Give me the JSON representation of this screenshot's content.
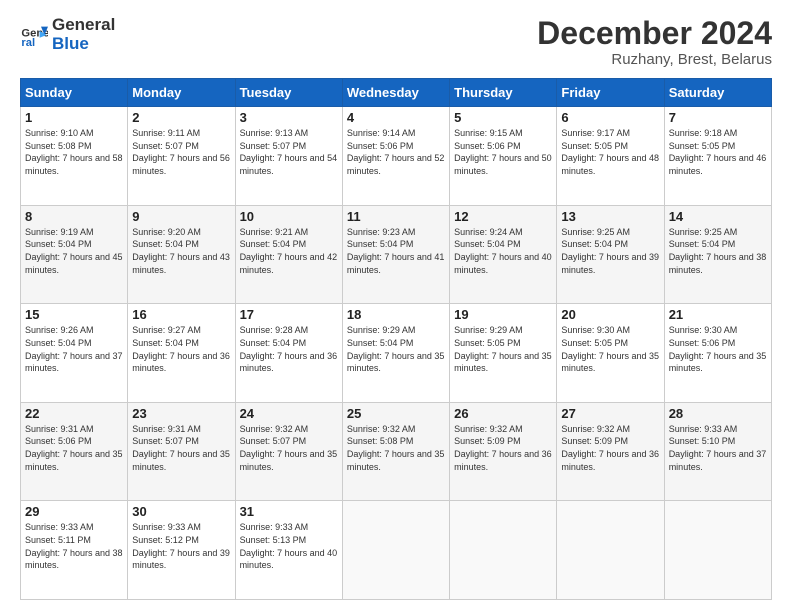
{
  "logo": {
    "line1": "General",
    "line2": "Blue"
  },
  "header": {
    "title": "December 2024",
    "subtitle": "Ruzhany, Brest, Belarus"
  },
  "weekdays": [
    "Sunday",
    "Monday",
    "Tuesday",
    "Wednesday",
    "Thursday",
    "Friday",
    "Saturday"
  ],
  "weeks": [
    [
      {
        "day": "1",
        "sunrise": "Sunrise: 9:10 AM",
        "sunset": "Sunset: 5:08 PM",
        "daylight": "Daylight: 7 hours and 58 minutes."
      },
      {
        "day": "2",
        "sunrise": "Sunrise: 9:11 AM",
        "sunset": "Sunset: 5:07 PM",
        "daylight": "Daylight: 7 hours and 56 minutes."
      },
      {
        "day": "3",
        "sunrise": "Sunrise: 9:13 AM",
        "sunset": "Sunset: 5:07 PM",
        "daylight": "Daylight: 7 hours and 54 minutes."
      },
      {
        "day": "4",
        "sunrise": "Sunrise: 9:14 AM",
        "sunset": "Sunset: 5:06 PM",
        "daylight": "Daylight: 7 hours and 52 minutes."
      },
      {
        "day": "5",
        "sunrise": "Sunrise: 9:15 AM",
        "sunset": "Sunset: 5:06 PM",
        "daylight": "Daylight: 7 hours and 50 minutes."
      },
      {
        "day": "6",
        "sunrise": "Sunrise: 9:17 AM",
        "sunset": "Sunset: 5:05 PM",
        "daylight": "Daylight: 7 hours and 48 minutes."
      },
      {
        "day": "7",
        "sunrise": "Sunrise: 9:18 AM",
        "sunset": "Sunset: 5:05 PM",
        "daylight": "Daylight: 7 hours and 46 minutes."
      }
    ],
    [
      {
        "day": "8",
        "sunrise": "Sunrise: 9:19 AM",
        "sunset": "Sunset: 5:04 PM",
        "daylight": "Daylight: 7 hours and 45 minutes."
      },
      {
        "day": "9",
        "sunrise": "Sunrise: 9:20 AM",
        "sunset": "Sunset: 5:04 PM",
        "daylight": "Daylight: 7 hours and 43 minutes."
      },
      {
        "day": "10",
        "sunrise": "Sunrise: 9:21 AM",
        "sunset": "Sunset: 5:04 PM",
        "daylight": "Daylight: 7 hours and 42 minutes."
      },
      {
        "day": "11",
        "sunrise": "Sunrise: 9:23 AM",
        "sunset": "Sunset: 5:04 PM",
        "daylight": "Daylight: 7 hours and 41 minutes."
      },
      {
        "day": "12",
        "sunrise": "Sunrise: 9:24 AM",
        "sunset": "Sunset: 5:04 PM",
        "daylight": "Daylight: 7 hours and 40 minutes."
      },
      {
        "day": "13",
        "sunrise": "Sunrise: 9:25 AM",
        "sunset": "Sunset: 5:04 PM",
        "daylight": "Daylight: 7 hours and 39 minutes."
      },
      {
        "day": "14",
        "sunrise": "Sunrise: 9:25 AM",
        "sunset": "Sunset: 5:04 PM",
        "daylight": "Daylight: 7 hours and 38 minutes."
      }
    ],
    [
      {
        "day": "15",
        "sunrise": "Sunrise: 9:26 AM",
        "sunset": "Sunset: 5:04 PM",
        "daylight": "Daylight: 7 hours and 37 minutes."
      },
      {
        "day": "16",
        "sunrise": "Sunrise: 9:27 AM",
        "sunset": "Sunset: 5:04 PM",
        "daylight": "Daylight: 7 hours and 36 minutes."
      },
      {
        "day": "17",
        "sunrise": "Sunrise: 9:28 AM",
        "sunset": "Sunset: 5:04 PM",
        "daylight": "Daylight: 7 hours and 36 minutes."
      },
      {
        "day": "18",
        "sunrise": "Sunrise: 9:29 AM",
        "sunset": "Sunset: 5:04 PM",
        "daylight": "Daylight: 7 hours and 35 minutes."
      },
      {
        "day": "19",
        "sunrise": "Sunrise: 9:29 AM",
        "sunset": "Sunset: 5:05 PM",
        "daylight": "Daylight: 7 hours and 35 minutes."
      },
      {
        "day": "20",
        "sunrise": "Sunrise: 9:30 AM",
        "sunset": "Sunset: 5:05 PM",
        "daylight": "Daylight: 7 hours and 35 minutes."
      },
      {
        "day": "21",
        "sunrise": "Sunrise: 9:30 AM",
        "sunset": "Sunset: 5:06 PM",
        "daylight": "Daylight: 7 hours and 35 minutes."
      }
    ],
    [
      {
        "day": "22",
        "sunrise": "Sunrise: 9:31 AM",
        "sunset": "Sunset: 5:06 PM",
        "daylight": "Daylight: 7 hours and 35 minutes."
      },
      {
        "day": "23",
        "sunrise": "Sunrise: 9:31 AM",
        "sunset": "Sunset: 5:07 PM",
        "daylight": "Daylight: 7 hours and 35 minutes."
      },
      {
        "day": "24",
        "sunrise": "Sunrise: 9:32 AM",
        "sunset": "Sunset: 5:07 PM",
        "daylight": "Daylight: 7 hours and 35 minutes."
      },
      {
        "day": "25",
        "sunrise": "Sunrise: 9:32 AM",
        "sunset": "Sunset: 5:08 PM",
        "daylight": "Daylight: 7 hours and 35 minutes."
      },
      {
        "day": "26",
        "sunrise": "Sunrise: 9:32 AM",
        "sunset": "Sunset: 5:09 PM",
        "daylight": "Daylight: 7 hours and 36 minutes."
      },
      {
        "day": "27",
        "sunrise": "Sunrise: 9:32 AM",
        "sunset": "Sunset: 5:09 PM",
        "daylight": "Daylight: 7 hours and 36 minutes."
      },
      {
        "day": "28",
        "sunrise": "Sunrise: 9:33 AM",
        "sunset": "Sunset: 5:10 PM",
        "daylight": "Daylight: 7 hours and 37 minutes."
      }
    ],
    [
      {
        "day": "29",
        "sunrise": "Sunrise: 9:33 AM",
        "sunset": "Sunset: 5:11 PM",
        "daylight": "Daylight: 7 hours and 38 minutes."
      },
      {
        "day": "30",
        "sunrise": "Sunrise: 9:33 AM",
        "sunset": "Sunset: 5:12 PM",
        "daylight": "Daylight: 7 hours and 39 minutes."
      },
      {
        "day": "31",
        "sunrise": "Sunrise: 9:33 AM",
        "sunset": "Sunset: 5:13 PM",
        "daylight": "Daylight: 7 hours and 40 minutes."
      },
      null,
      null,
      null,
      null
    ]
  ]
}
